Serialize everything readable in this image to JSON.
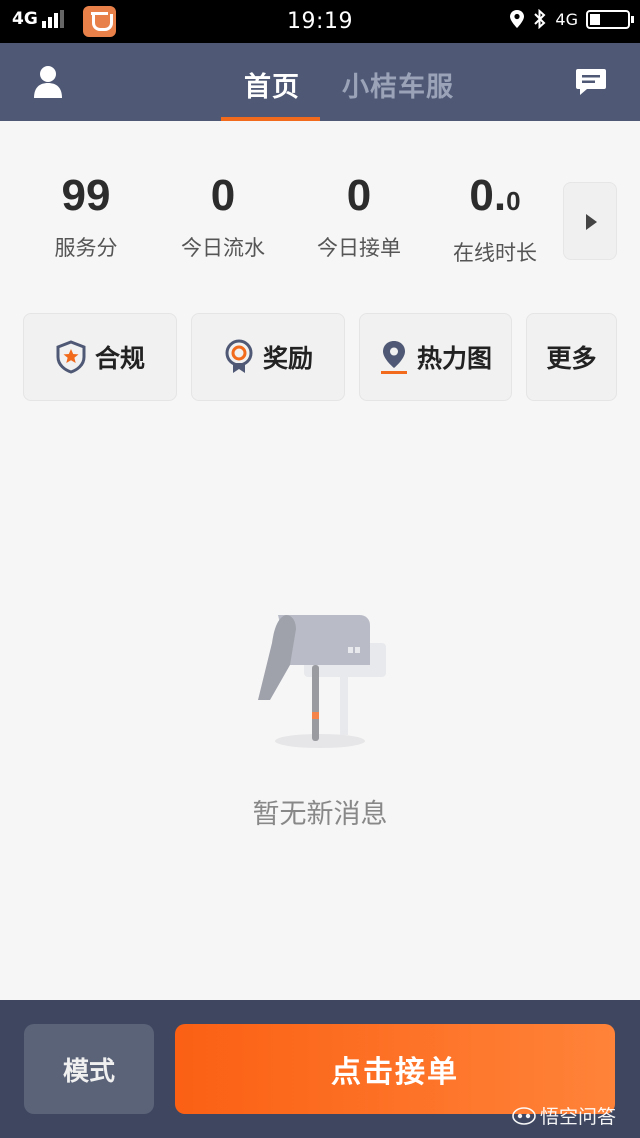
{
  "status_bar": {
    "network_left": "4G",
    "time": "19:19",
    "network_right": "4G",
    "icons": [
      "signal-icon",
      "didi-app-icon",
      "location-icon",
      "bluetooth-icon",
      "battery-icon"
    ]
  },
  "nav": {
    "tabs": [
      {
        "label": "首页",
        "active": true
      },
      {
        "label": "小桔车服",
        "active": false
      }
    ],
    "accent_color": "#f26b1d",
    "bar_color": "#4f5975"
  },
  "stats": [
    {
      "value": "99",
      "label": "服务分"
    },
    {
      "value": "0",
      "label": "今日流水"
    },
    {
      "value": "0",
      "label": "今日接单"
    },
    {
      "value_main": "0.",
      "value_small": "0",
      "label": "在线时长"
    }
  ],
  "quick_actions": [
    {
      "label": "合规",
      "icon": "shield-icon"
    },
    {
      "label": "奖励",
      "icon": "medal-icon"
    },
    {
      "label": "热力图",
      "icon": "map-pin-icon"
    },
    {
      "label": "更多",
      "icon": ""
    }
  ],
  "empty_state": {
    "message": "暂无新消息",
    "icon": "mailbox-icon"
  },
  "bottom_bar": {
    "mode_label": "模式",
    "order_label": "点击接单",
    "order_color": "#fb6013"
  },
  "watermark": {
    "text": "悟空问答"
  }
}
